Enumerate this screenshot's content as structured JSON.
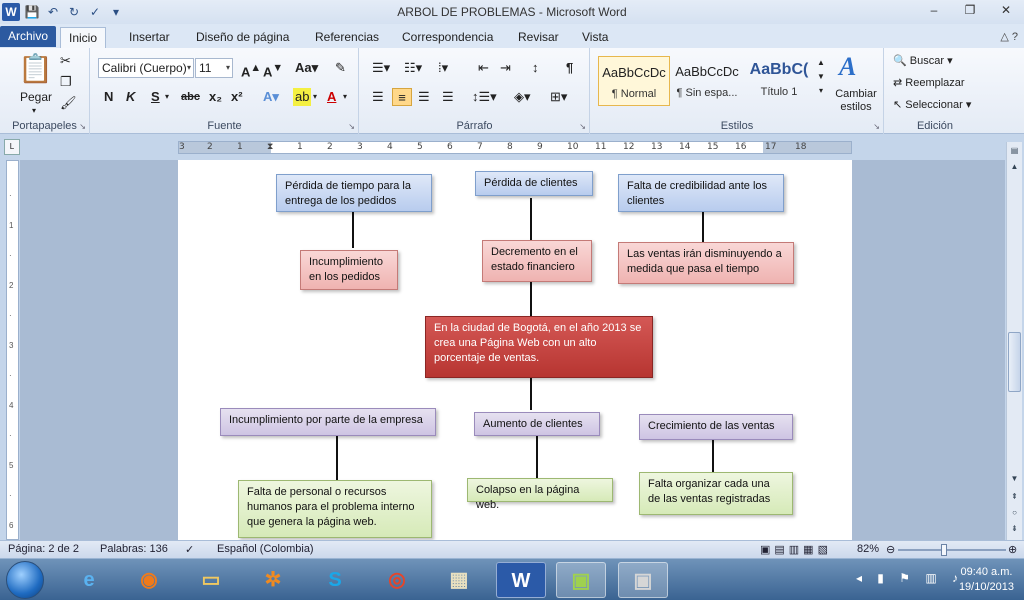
{
  "window": {
    "title": "ARBOL DE PROBLEMAS  -  Microsoft Word",
    "controls": [
      "‒",
      "❐",
      "✕"
    ]
  },
  "tabs": {
    "file": "Archivo",
    "items": [
      "Inicio",
      "Insertar",
      "Diseño de página",
      "Referencias",
      "Correspondencia",
      "Revisar",
      "Vista"
    ],
    "active": "Inicio"
  },
  "ribbon": {
    "clipboard": {
      "paste": "Pegar",
      "label": "Portapapeles"
    },
    "font": {
      "name": "Calibri (Cuerpo)",
      "size": "11",
      "label": "Fuente"
    },
    "paragraph": {
      "label": "Párrafo"
    },
    "styles": {
      "items": [
        {
          "sample": "AaBbCcDc",
          "name": "¶ Normal"
        },
        {
          "sample": "AaBbCcDc",
          "name": "¶ Sin espa..."
        },
        {
          "sample": "AaBbC(",
          "name": "Título 1"
        }
      ],
      "change": "Cambiar estilos",
      "label": "Estilos"
    },
    "editing": {
      "find": "Buscar",
      "replace": "Reemplazar",
      "select": "Seleccionar",
      "label": "Edición"
    }
  },
  "ruler": {
    "numbers": [
      "3",
      "2",
      "1",
      "1",
      "2",
      "3",
      "4",
      "5",
      "6",
      "7",
      "8",
      "9",
      "10",
      "11",
      "12",
      "13",
      "14",
      "15",
      "16",
      "17",
      "18"
    ]
  },
  "diagram": {
    "effects_top": {
      "left": "Pérdida de tiempo  para la entrega  de los  pedidos",
      "center": "Pérdida de clientes",
      "right": "Falta de credibilidad ante los clientes"
    },
    "effects_mid": {
      "left": "Incumplimiento en los pedidos",
      "center": "Decremento en el estado financiero",
      "right": "Las ventas irán disminuyendo a medida que pasa el tiempo"
    },
    "problem": "En la ciudad de Bogotá, en el año 2013 se crea una  Página  Web con un alto porcentaje de  ventas.",
    "causes": {
      "left": "Incumplimiento por  parte de la empresa",
      "center": "Aumento de clientes",
      "right": "Crecimiento de las  ventas"
    },
    "subcauses": {
      "left": "Falta  de  personal o recursos humanos para el problema interno que genera la  página web.",
      "center": "Colapso en la página web.",
      "right": "Falta organizar cada una de las ventas registradas"
    }
  },
  "status": {
    "page": "Página: 2 de 2",
    "words": "Palabras: 136",
    "language": "Español (Colombia)",
    "zoom": "82%",
    "zoom_level": 0.42
  },
  "taskbar": {
    "time": "09:40 a.m.",
    "date": "19/10/2013"
  }
}
